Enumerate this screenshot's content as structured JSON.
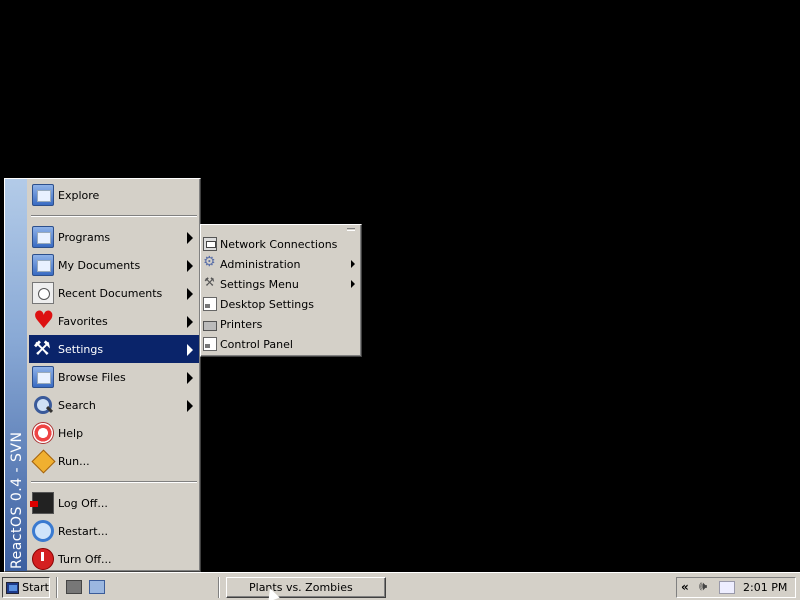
{
  "start_menu": {
    "banner_text": "ReactOS  0.4 - SVN",
    "items": [
      {
        "label": "Explore",
        "icon": "explore-icon",
        "submenu": false
      },
      {
        "label": "Programs",
        "icon": "programs-folder-icon",
        "submenu": true
      },
      {
        "label": "My Documents",
        "icon": "documents-folder-icon",
        "submenu": true
      },
      {
        "label": "Recent Documents",
        "icon": "recent-documents-icon",
        "submenu": true
      },
      {
        "label": "Favorites",
        "icon": "favorites-heart-icon",
        "submenu": true
      },
      {
        "label": "Settings",
        "icon": "settings-tools-icon",
        "submenu": true,
        "selected": true
      },
      {
        "label": "Browse Files",
        "icon": "browse-folder-icon",
        "submenu": true
      },
      {
        "label": "Search",
        "icon": "search-magnifier-icon",
        "submenu": true
      },
      {
        "label": "Help",
        "icon": "help-lifebuoy-icon",
        "submenu": false
      },
      {
        "label": "Run...",
        "icon": "run-icon",
        "submenu": false
      },
      {
        "label": "Log Off...",
        "icon": "logoff-icon",
        "submenu": false
      },
      {
        "label": "Restart...",
        "icon": "restart-icon",
        "submenu": false
      },
      {
        "label": "Turn Off...",
        "icon": "power-icon",
        "submenu": false
      }
    ]
  },
  "settings_submenu": {
    "items": [
      {
        "label": "Network Connections",
        "icon": "network-connections-icon",
        "submenu": false
      },
      {
        "label": "Administration",
        "icon": "administration-icon",
        "submenu": true
      },
      {
        "label": "Settings Menu",
        "icon": "settings-menu-icon",
        "submenu": true
      },
      {
        "label": "Desktop Settings",
        "icon": "desktop-settings-icon",
        "submenu": false
      },
      {
        "label": "Printers",
        "icon": "printer-icon",
        "submenu": false
      },
      {
        "label": "Control Panel",
        "icon": "control-panel-icon",
        "submenu": false
      }
    ]
  },
  "taskbar": {
    "start_label": "Start",
    "task_label": "Plants vs. Zombies",
    "clock": "2:01 PM",
    "tray_chevron": "«",
    "volume_glyph": "🕪"
  },
  "colors": {
    "desktop": "#000000",
    "face": "#d4d0c8",
    "selection": "#0a246a"
  }
}
